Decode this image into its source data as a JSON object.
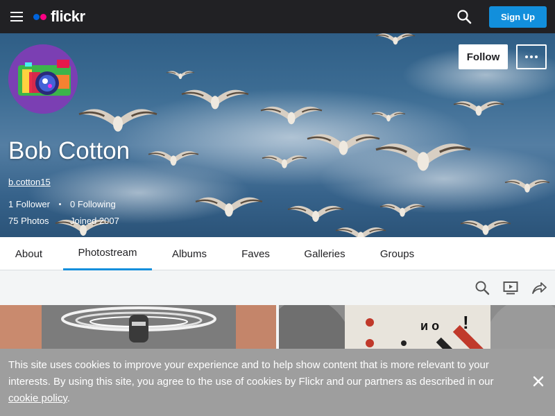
{
  "nav": {
    "logo_text": "flickr",
    "signup_label": "Sign Up",
    "menu_icon": "hamburger-icon",
    "search_icon": "search-icon",
    "brand_blue": "#0063dc",
    "brand_pink": "#ff0084",
    "accent": "#128fdc"
  },
  "profile": {
    "name": "Bob Cotton",
    "username": "b.cotton15",
    "followers": "1 Follower",
    "following": "0 Following",
    "photos": "75 Photos",
    "joined": "Joined 2007",
    "follow_label": "Follow",
    "more_icon": "more-dots-icon"
  },
  "tabs": [
    {
      "label": "About"
    },
    {
      "label": "Photostream",
      "active": true
    },
    {
      "label": "Albums"
    },
    {
      "label": "Faves"
    },
    {
      "label": "Galleries"
    },
    {
      "label": "Groups"
    }
  ],
  "toolbar_icons": [
    "search-icon",
    "slideshow-icon",
    "share-icon"
  ],
  "photos_labels": [
    "!",
    "и о"
  ],
  "cookie": {
    "text": "This site uses cookies to improve your experience and to help show content that is more relevant to your interests. By using this site, you agree to the use of cookies by Flickr and our partners as described in our ",
    "link": "cookie policy",
    "suffix": ".",
    "close_icon": "close-icon"
  }
}
